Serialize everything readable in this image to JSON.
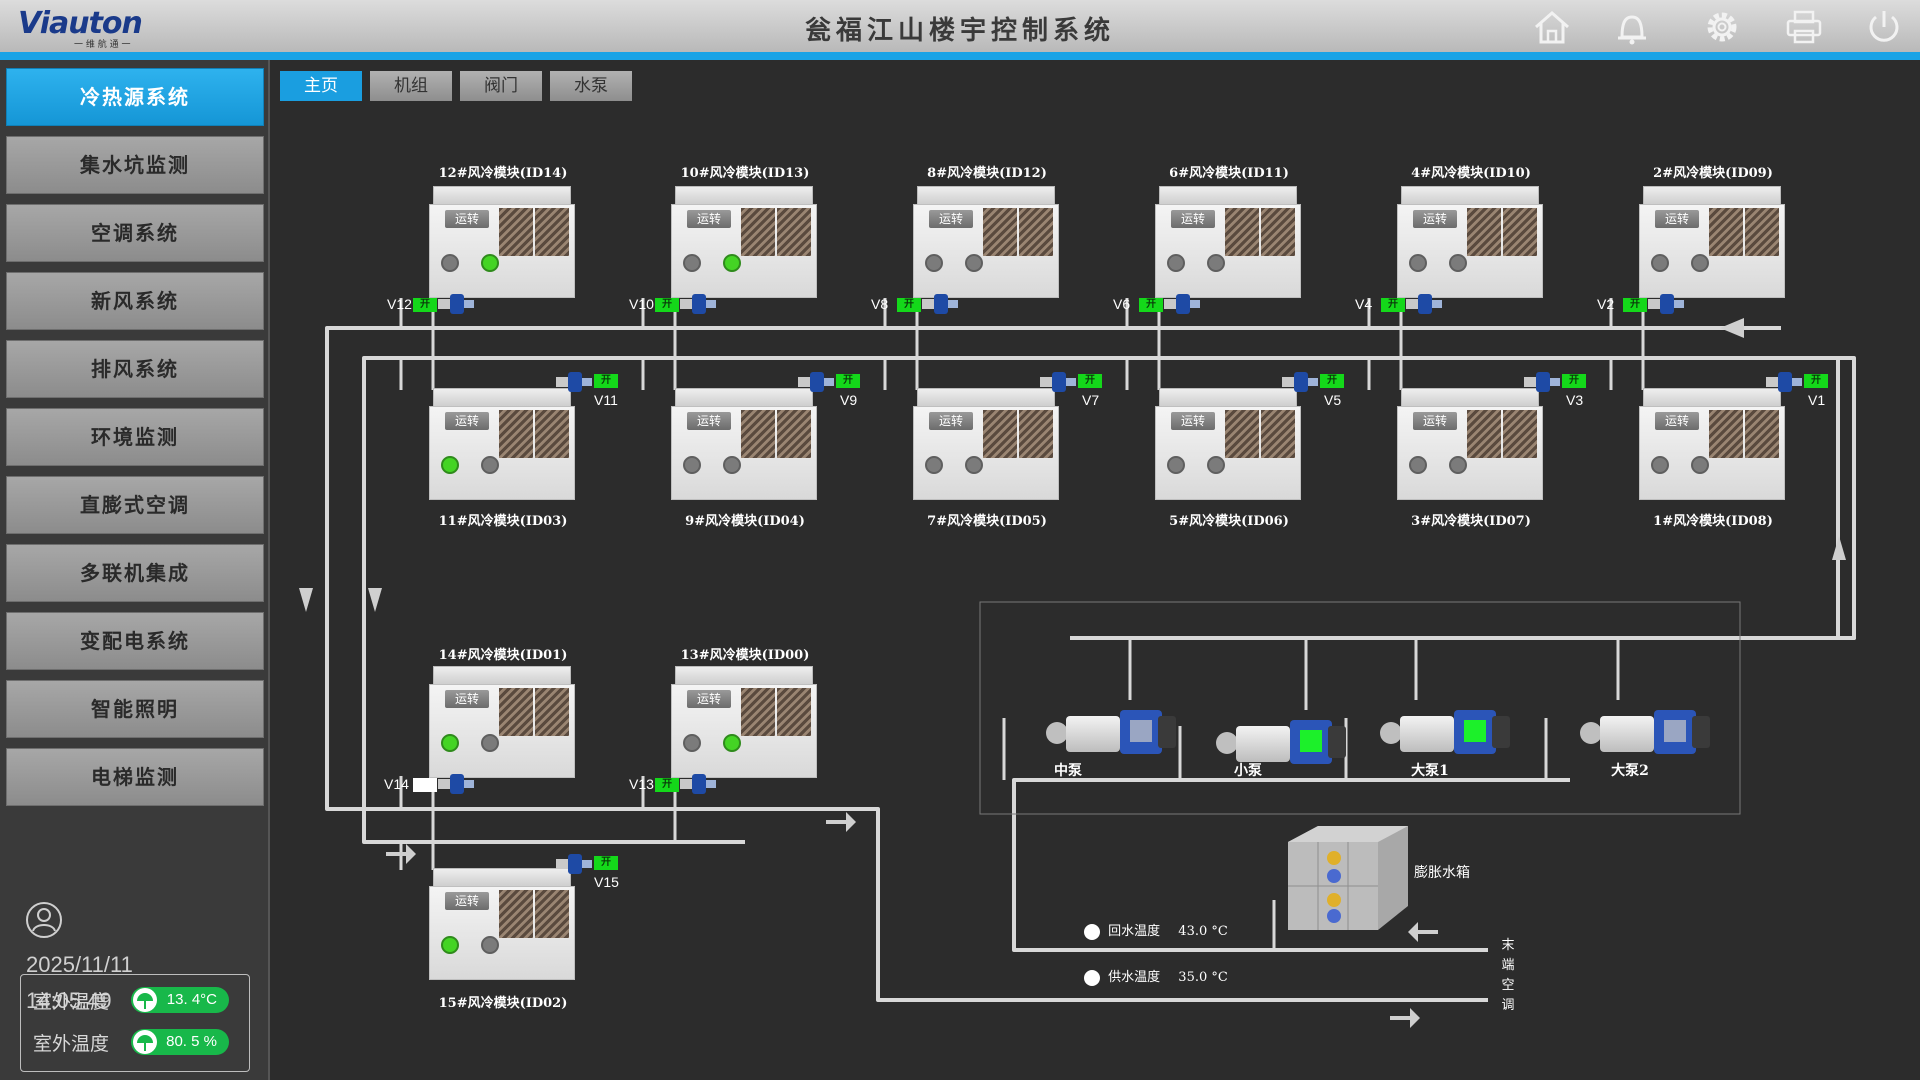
{
  "header": {
    "logo_text": "Viauton",
    "logo_sub": "一 维 航 通 一",
    "title": "瓮福江山楼宇控制系统",
    "icons": [
      "home-icon",
      "bell-icon",
      "gear-icon",
      "printer-icon",
      "power-icon"
    ]
  },
  "sidebar": {
    "items": [
      {
        "label": "冷热源系统",
        "active": true
      },
      {
        "label": "集水坑监测"
      },
      {
        "label": "空调系统"
      },
      {
        "label": "新风系统"
      },
      {
        "label": "排风系统"
      },
      {
        "label": "环境监测"
      },
      {
        "label": "直膨式空调"
      },
      {
        "label": "多联机集成"
      },
      {
        "label": "变配电系统"
      },
      {
        "label": "智能照明"
      },
      {
        "label": "电梯监测"
      }
    ],
    "date": "2025/11/11",
    "time": "14:05:49",
    "env": [
      {
        "label": "室外温度",
        "value": "13. 4°C"
      },
      {
        "label": "室外温度",
        "value": "80. 5 %"
      }
    ]
  },
  "tabs": [
    {
      "label": "主页",
      "active": true
    },
    {
      "label": "机组"
    },
    {
      "label": "阀门"
    },
    {
      "label": "水泵"
    }
  ],
  "modules": {
    "run_label": "运转",
    "top_row": [
      {
        "name": "12#风冷模块(ID14)",
        "valve": "V12",
        "state": "开",
        "ind": [
          false,
          true
        ]
      },
      {
        "name": "10#风冷模块(ID13)",
        "valve": "V10",
        "state": "开",
        "ind": [
          false,
          true
        ]
      },
      {
        "name": "8#风冷模块(ID12)",
        "valve": "V8",
        "state": "开",
        "ind": [
          false,
          false
        ]
      },
      {
        "name": "6#风冷模块(ID11)",
        "valve": "V6",
        "state": "开",
        "ind": [
          false,
          false
        ]
      },
      {
        "name": "4#风冷模块(ID10)",
        "valve": "V4",
        "state": "开",
        "ind": [
          false,
          false
        ]
      },
      {
        "name": "2#风冷模块(ID09)",
        "valve": "V2",
        "state": "开",
        "ind": [
          false,
          false
        ]
      }
    ],
    "mid_row": [
      {
        "name": "11#风冷模块(ID03)",
        "valve": "V11",
        "state": "开",
        "ind": [
          true,
          false
        ]
      },
      {
        "name": "9#风冷模块(ID04)",
        "valve": "V9",
        "state": "开",
        "ind": [
          false,
          false
        ]
      },
      {
        "name": "7#风冷模块(ID05)",
        "valve": "V7",
        "state": "开",
        "ind": [
          false,
          false
        ]
      },
      {
        "name": "5#风冷模块(ID06)",
        "valve": "V5",
        "state": "开",
        "ind": [
          false,
          false
        ]
      },
      {
        "name": "3#风冷模块(ID07)",
        "valve": "V3",
        "state": "开",
        "ind": [
          false,
          false
        ]
      },
      {
        "name": "1#风冷模块(ID08)",
        "valve": "V1",
        "state": "开",
        "ind": [
          false,
          false
        ]
      }
    ],
    "low_row": [
      {
        "name": "14#风冷模块(ID01)",
        "valve": "V14",
        "state": "",
        "ind": [
          true,
          false
        ]
      },
      {
        "name": "13#风冷模块(ID00)",
        "valve": "V13",
        "state": "开",
        "ind": [
          false,
          true
        ]
      }
    ],
    "bottom": {
      "name": "15#风冷模块(ID02)",
      "valve": "V15",
      "state": "开",
      "ind": [
        true,
        false
      ]
    }
  },
  "pumps": [
    {
      "name": "中泵",
      "on": false
    },
    {
      "name": "小泵",
      "on": true
    },
    {
      "name": "大泵1",
      "on": true
    },
    {
      "name": "大泵2",
      "on": false
    }
  ],
  "tank_label": "膨胀水箱",
  "readings": {
    "return": {
      "label": "回水温度",
      "value": "43.0 °C"
    },
    "supply": {
      "label": "供水温度",
      "value": "35.0 °C"
    }
  },
  "end_label": "末端空调",
  "colors": {
    "accent": "#19a3e6",
    "status_on": "#14d81a",
    "indicator_on": "#44d424"
  }
}
